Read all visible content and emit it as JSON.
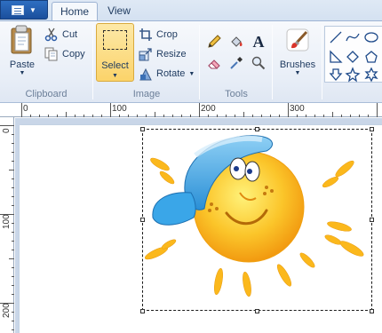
{
  "tabs": {
    "home": "Home",
    "view": "View"
  },
  "clipboard": {
    "paste_label": "Paste",
    "cut_label": "Cut",
    "copy_label": "Copy",
    "group_label": "Clipboard"
  },
  "image": {
    "select_label": "Select",
    "crop_label": "Crop",
    "resize_label": "Resize",
    "rotate_label": "Rotate",
    "group_label": "Image"
  },
  "tools": {
    "group_label": "Tools",
    "text_tool_glyph": "A"
  },
  "brushes": {
    "label": "Brushes"
  },
  "ruler": {
    "horizontal": [
      "0",
      "100",
      "200",
      "300"
    ],
    "vertical": [
      "0",
      "100",
      "200"
    ]
  },
  "colors": {
    "accent": "#2f6fc2",
    "selected_tool": "#fbd36a",
    "workspace_bg": "#c9d6e8"
  }
}
